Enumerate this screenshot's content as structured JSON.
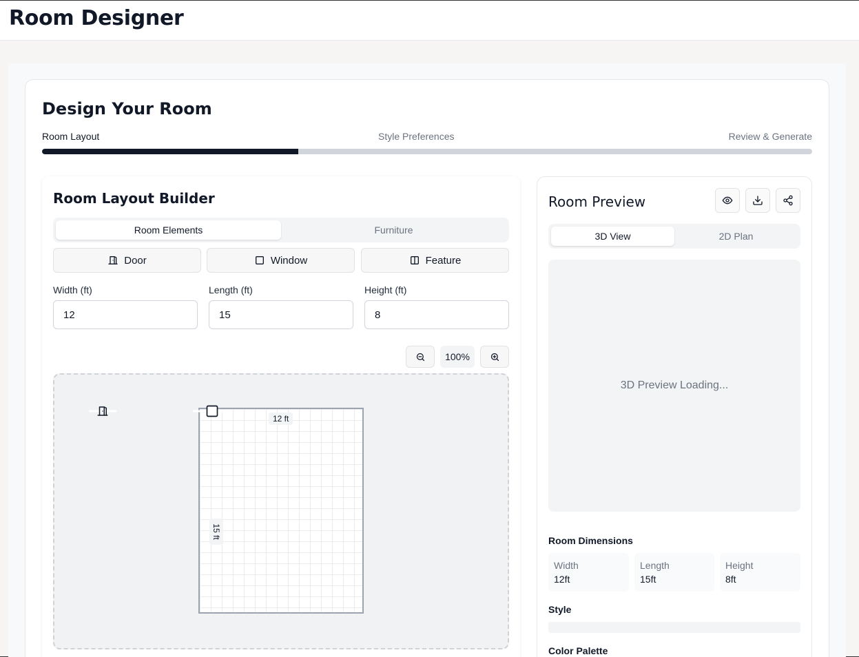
{
  "app": {
    "title": "Room Designer"
  },
  "page": {
    "heading": "Design Your Room"
  },
  "steps": [
    {
      "label": "Room Layout",
      "active": true
    },
    {
      "label": "Style Preferences",
      "active": false
    },
    {
      "label": "Review & Generate",
      "active": false
    }
  ],
  "progress": {
    "percent": 33.3
  },
  "builder": {
    "title": "Room Layout Builder",
    "tabs": [
      {
        "label": "Room Elements",
        "active": true
      },
      {
        "label": "Furniture",
        "active": false
      }
    ],
    "element_buttons": {
      "door": "Door",
      "window": "Window",
      "feature": "Feature"
    },
    "fields": {
      "width": {
        "label": "Width (ft)",
        "value": "12"
      },
      "length": {
        "label": "Length (ft)",
        "value": "15"
      },
      "height": {
        "label": "Height (ft)",
        "value": "8"
      }
    },
    "zoom": {
      "level": "100%"
    },
    "canvas": {
      "width_label": "12 ft",
      "length_label": "15 ft"
    }
  },
  "preview": {
    "title": "Room Preview",
    "tabs": [
      {
        "label": "3D View",
        "active": true
      },
      {
        "label": "2D Plan",
        "active": false
      }
    ],
    "loading_text": "3D Preview Loading...",
    "dimensions": {
      "title": "Room Dimensions",
      "items": [
        {
          "label": "Width",
          "value": "12ft"
        },
        {
          "label": "Length",
          "value": "15ft"
        },
        {
          "label": "Height",
          "value": "8ft"
        }
      ]
    },
    "style": {
      "title": "Style"
    },
    "palette": {
      "title": "Color Palette"
    }
  },
  "icons": {
    "door": "door-icon",
    "window": "square-icon",
    "feature": "columns-icon",
    "zoom_out": "zoom-out-icon",
    "zoom_in": "zoom-in-icon",
    "view": "eye-icon",
    "download": "download-icon",
    "share": "share-icon"
  },
  "colors": {
    "accent": "#111827",
    "track": "#d1d5db"
  }
}
